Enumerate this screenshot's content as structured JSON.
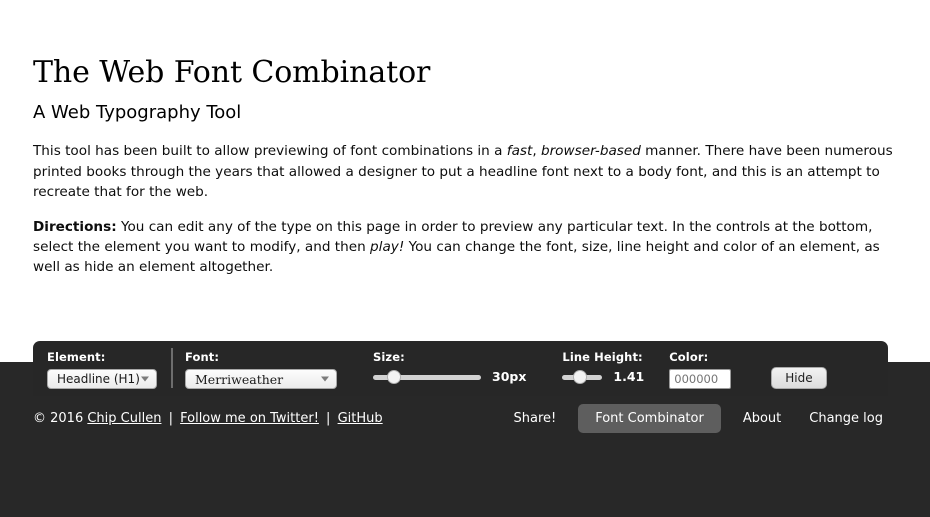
{
  "page": {
    "headline": "The Web Font Combinator",
    "subhead": "A Web Typography Tool",
    "paragraph1_part1": "This tool has been built to allow previewing of font combinations in a ",
    "paragraph1_em1": "fast",
    "paragraph1_part2": ", ",
    "paragraph1_em2": "browser-based",
    "paragraph1_part3": " manner. There have been numerous printed books through the years that allowed a designer to put a headline font next to a body font, and this is an attempt to recreate that for the web.",
    "paragraph2_strong": "Directions:",
    "paragraph2_part1": " You can edit any of the type on this page in order to preview any particular text. In the controls at the bottom, select the element you want to modify, and then ",
    "paragraph2_em1": "play!",
    "paragraph2_part2": " You can change the font, size, line height and color of an element, as well as hide an element altogether."
  },
  "controls": {
    "element": {
      "label": "Element:",
      "selected": "Headline (H1)"
    },
    "font": {
      "label": "Font:",
      "selected": "Merriweather"
    },
    "size": {
      "label": "Size:",
      "value": "30px"
    },
    "line_height": {
      "label": "Line Height:",
      "value": "1.41"
    },
    "color": {
      "label": "Color:",
      "value": "",
      "placeholder": "000000"
    },
    "hide_label": "Hide"
  },
  "footer": {
    "copyright_prefix": "© 2016 ",
    "author_link": "Chip Cullen",
    "separator": " | ",
    "twitter_link": "Follow me on Twitter!",
    "github_link": "GitHub",
    "nav": [
      {
        "label": "Share!",
        "active": false
      },
      {
        "label": "Font Combinator",
        "active": true
      },
      {
        "label": "About",
        "active": false
      },
      {
        "label": "Change log",
        "active": false
      }
    ]
  },
  "colors": {
    "footer_bg": "#282828",
    "control_bg": "#272727",
    "active_nav_bg": "#5e5e5e",
    "text": "#000000"
  }
}
